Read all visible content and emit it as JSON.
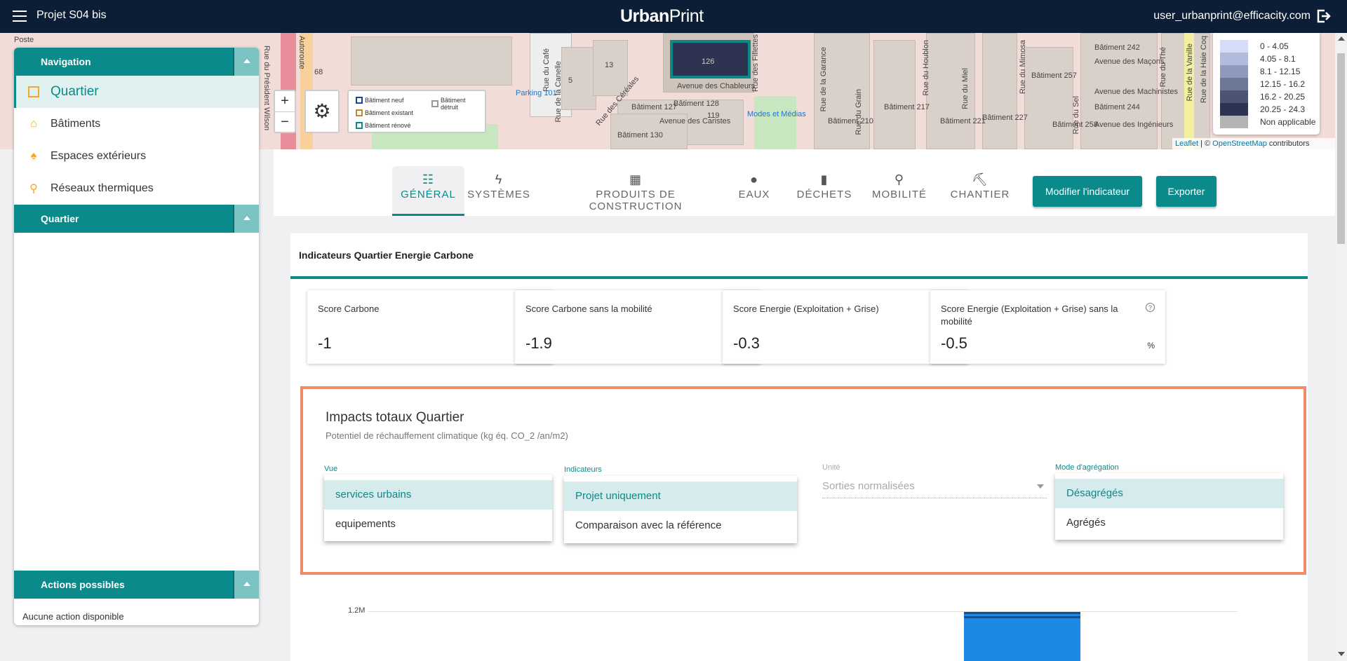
{
  "topbar": {
    "project": "Projet S04 bis",
    "logo_bold": "Urban",
    "logo_light": "Print",
    "user": "user_urbanprint@efficacity.com",
    "colors": {
      "bg": "#0b1e35"
    }
  },
  "map": {
    "labels": [
      "Poste",
      "Rue du Président Wilson",
      "Autoroute",
      "Avenue des Chableurs",
      "Rue du Café",
      "Rue de la Canelle",
      "Rue des Céréales",
      "Avenue des Caristes",
      "Parking 101",
      "Bâtiment 127",
      "Bâtiment 128",
      "Bâtiment 130",
      "Modes et Médias",
      "Rue des Fillettes",
      "Rue de la Garance",
      "Rue du Grain",
      "Bâtiment 210",
      "Bâtiment 217",
      "Rue du Houblon",
      "Rue du Miel",
      "Bâtiment 221",
      "Bâtiment 227",
      "Rue du Mimosa",
      "Bâtiment 257",
      "Bâtiment 258",
      "Rue du Sel",
      "Bâtiment 242",
      "Avenue des Maçons",
      "Avenue des Machinistes",
      "Bâtiment 244",
      "Avenue des Ingénieurs",
      "Rue du Thé",
      "Rue de la Vanille",
      "Rue de la Haie Coq",
      "119",
      "126",
      "13",
      "5",
      "68"
    ],
    "zoom_in": "+",
    "zoom_out": "−",
    "legend": [
      {
        "label": "Bâtiment neuf",
        "color": "#1f3f9a"
      },
      {
        "label": "Bâtiment détruit",
        "color": "#999999"
      },
      {
        "label": "Bâtiment existant",
        "color": "#c8862a"
      },
      {
        "label": "Bâtiment rénové",
        "color": "#0a8a8a"
      }
    ],
    "color_legend": [
      {
        "label": "0 - 4.05",
        "color": "#d4dcf7"
      },
      {
        "label": "4.05 - 8.1",
        "color": "#b1bbdc"
      },
      {
        "label": "8.1 - 12.15",
        "color": "#8f99bb"
      },
      {
        "label": "12.15 - 16.2",
        "color": "#6d7797"
      },
      {
        "label": "16.2 - 20.25",
        "color": "#4b5475"
      },
      {
        "label": "20.25 - 24.3",
        "color": "#2e3351"
      },
      {
        "label": "Non applicable",
        "color": "#b4b4b4"
      }
    ],
    "attribution": {
      "leaflet": "Leaflet",
      "sep": " | © ",
      "osm": "OpenStreetMap",
      "rest": " contributors"
    }
  },
  "sidebar": {
    "navigation": "Navigation",
    "items": [
      {
        "label": "Quartier",
        "icon": "square-outline-icon",
        "active": true
      },
      {
        "label": "Bâtiments",
        "icon": "building-icon"
      },
      {
        "label": "Espaces extérieurs",
        "icon": "tree-icon"
      },
      {
        "label": "Réseaux thermiques",
        "icon": "network-icon"
      }
    ],
    "quartier": "Quartier",
    "actions": "Actions possibles",
    "no_action": "Aucune action disponible"
  },
  "tabs": [
    {
      "label": "GÉNÉRAL",
      "icon": "sliders-icon",
      "active": true
    },
    {
      "label": "SYSTÈMES",
      "icon": "bolt-icon"
    },
    {
      "label": "PRODUITS DE CONSTRUCTION",
      "icon": "bricks-icon"
    },
    {
      "label": "EAUX",
      "icon": "drop-icon"
    },
    {
      "label": "DÉCHETS",
      "icon": "trash-icon"
    },
    {
      "label": "MOBILITÉ",
      "icon": "bicycle-icon"
    },
    {
      "label": "CHANTIER",
      "icon": "excavator-icon"
    }
  ],
  "buttons": {
    "modify": "Modifier l'indicateur",
    "export": "Exporter"
  },
  "card": {
    "title": "Indicateurs Quartier Energie Carbone",
    "scores": [
      {
        "title": "Score Carbone",
        "value": "-1",
        "unit": "%"
      },
      {
        "title": "Score Carbone sans la mobilité",
        "value": "-1.9",
        "unit": "%"
      },
      {
        "title": "Score Energie (Exploitation + Grise)",
        "value": "-0.3",
        "unit": "%"
      },
      {
        "title": "Score Energie (Exploitation + Grise) sans la mobilité",
        "value": "-0.5",
        "unit": "%"
      }
    ]
  },
  "impact": {
    "title": "Impacts totaux Quartier",
    "subtitle": "Potentiel de réchauffement climatique (kg éq. CO_2 /an/m2)",
    "vue": {
      "label": "Vue",
      "options": [
        "services urbains",
        "equipements"
      ],
      "selected": 0
    },
    "indicateurs": {
      "label": "Indicateurs",
      "options": [
        "Projet uniquement",
        "Comparaison avec la référence"
      ],
      "selected": 0
    },
    "unite": {
      "label": "Unité",
      "value": "Sorties normalisées"
    },
    "aggregation": {
      "label": "Mode d'agrégation",
      "options": [
        "Désagrégés",
        "Agrégés"
      ],
      "selected": 0
    },
    "highlight_color": "#f28b64"
  },
  "chart_data": {
    "type": "bar",
    "y_ticks": [
      "1.2M"
    ],
    "note": "partially visible",
    "series_color": "#1e88e5"
  }
}
